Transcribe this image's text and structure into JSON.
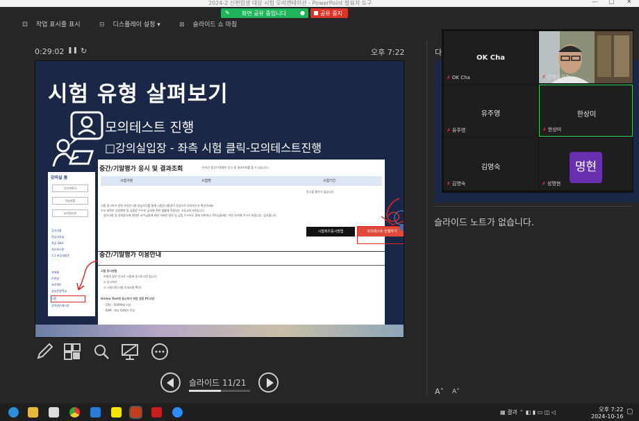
{
  "window": {
    "title": "2024-2 신편입생 대상 시험 오리엔테이션 - PowerPoint 발표자 도구"
  },
  "screen_share": {
    "status": "화면 공유 중입니다",
    "stop_label": "공유 중지"
  },
  "toolbar": {
    "taskbar_label": "작업 표시줄 표시",
    "display_label": "디스플레이 설정 ▾",
    "end_show_label": "슬라이드 쇼 마침"
  },
  "presenter": {
    "timer": "0:29:02",
    "clock": "오후 7:22",
    "next_label": "다",
    "notes": "슬라이드 노트가 없습니다.",
    "slide_counter": "슬라이드 11/21",
    "progress": 0.524
  },
  "slide": {
    "title": "시험 유형 살펴보기",
    "sub1": "모의테스트 진행",
    "sub2": "□강의실입장 - 좌측 시험 클릭-모의테스트진행",
    "left_panel": {
      "home": "강의실 홈",
      "btn1": "강의계획서",
      "btn2": "학습현황",
      "btn3": "요약정리본",
      "items": [
        "공지사항",
        "학습자료실",
        "학습 Q&A",
        "자유게시판",
        "1:1 비공개질문"
      ],
      "items2": [
        "과제물",
        "토론방",
        "프로젝트",
        "실습운영학습",
        "시험",
        "성적관리게시판"
      ]
    },
    "main_panel": {
      "section1": "중간/기말평가 응시 및 결과조회",
      "section1_note": "온라인 중간/기말평가 응시 및 결과조회를 할 수 있습니다.",
      "col1": "시험구분",
      "col2": "시험명",
      "col3": "시험기간",
      "empty": "응시할 평가가 없습니다.",
      "note1": "시험 응시하기 전에 온라인시험 연습하기를 통해 시험응시환경이 정상으로 보여지는지 확인하세요",
      "note2": "우리 대학은 부정행위 및 금품등 수수의 금지에 관한 법률에 적용되는 고등교육기관입니다.",
      "note3": "청거사항 및 강의동의계 관련한 교수님들께 대한 어떠한 청탁 및 금품 수수라도 법에 저촉되니 학우님들께는 어떤 유의해 주시기 바랍니다. 감사합니다.",
      "guide_btn": "시험퀴즈응시방법",
      "test_btn": "모의테스트 진행하기",
      "section2": "중간/기말평가 이용안내",
      "g1": "시험 응시방법",
      "g2": "아래의 같은 순서로 시험에 응시하시면 됩니다.",
      "g3": "① 응시하기",
      "g4": "② 시험시작(시험 안내사항 확인)",
      "g5": "Online Test에 응시하기 위한 권장 PC사양",
      "g6": "- CPU : 500MHz 이상",
      "g7": "- RAM : 최소 64메가 이상"
    }
  },
  "participants": [
    {
      "name": "OK Cha",
      "label": "OK Cha"
    },
    {
      "name": "",
      "label": "강태구교수"
    },
    {
      "name": "유주영",
      "label": "유주영"
    },
    {
      "name": "한상미",
      "label": "한상미"
    },
    {
      "name": "김영숙",
      "label": "김영숙"
    },
    {
      "name": "명현",
      "label": "성명현"
    }
  ],
  "taskbar": {
    "tray": "결과",
    "time": "오후 7:22",
    "date": "2024-10-16"
  },
  "colors": {
    "share_green": "#1fb35a",
    "stop_red": "#d9332a",
    "slide_navy": "#1a2746",
    "active_speaker": "#2fd35a",
    "avatar_purple": "#6a2fb0"
  }
}
